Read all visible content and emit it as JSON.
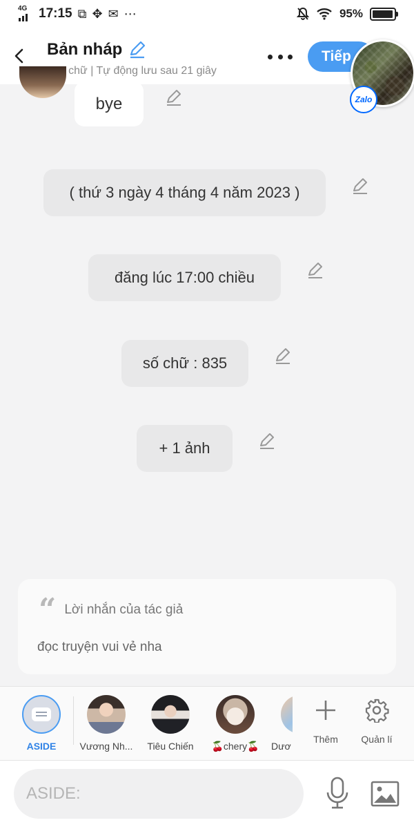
{
  "status_bar": {
    "network": "4G",
    "time": "17:15",
    "battery_percent": "95%",
    "battery_level": 0.95
  },
  "header": {
    "title": "Bản nháp",
    "subtitle": "835 chữ | Tự động lưu sau 21 giây",
    "next_label": "Tiếp"
  },
  "floating": {
    "badge": "Zalo"
  },
  "messages": [
    {
      "text": "bye"
    },
    {
      "text": "( thứ 3 ngày 4 tháng 4 năm 2023 )"
    },
    {
      "text": "đăng lúc 17:00 chiều"
    },
    {
      "text": "số chữ : 835"
    },
    {
      "text": "+ 1 ảnh"
    }
  ],
  "author_note": {
    "title": "Lời nhắn của tác giả",
    "body": "đọc truyện vui vẻ nha"
  },
  "characters": [
    {
      "name": "ASIDE"
    },
    {
      "name": "Vương Nh..."
    },
    {
      "name": "Tiêu Chiến"
    },
    {
      "name": "🍒chery🍒"
    },
    {
      "name": "Dươ"
    }
  ],
  "tools": {
    "add_label": "Thêm",
    "manage_label": "Quản lí"
  },
  "composer": {
    "placeholder": "ASIDE:",
    "value": ""
  }
}
